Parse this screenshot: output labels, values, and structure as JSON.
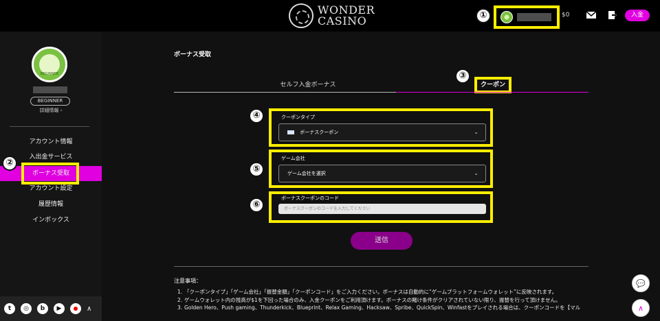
{
  "header": {
    "logo_line1": "WONDER",
    "logo_line2": "CASINO",
    "balance": "$0",
    "deposit_label": "入金"
  },
  "markers": [
    "①",
    "②",
    "③",
    "④",
    "⑤",
    "⑥"
  ],
  "sidebar": {
    "badge_label": "BEGINNER",
    "rank": "BEGINNER",
    "details": "詳細情報",
    "items": [
      {
        "label": "アカウント情報"
      },
      {
        "label": "入出金サービス"
      },
      {
        "label": "ボーナス受取"
      },
      {
        "label": "アカウント設定"
      },
      {
        "label": "履歴情報"
      },
      {
        "label": "インボックス"
      }
    ]
  },
  "main": {
    "title": "ボーナス受取",
    "tabs": [
      {
        "label": "セルフ入金ボーナス"
      },
      {
        "label": "クーポン"
      }
    ],
    "coupon_type": {
      "label": "クーポンタイプ",
      "value": "ボーナスクーポン"
    },
    "game_company": {
      "label": "ゲーム会社",
      "value": "ゲーム会社を選択"
    },
    "coupon_code": {
      "label": "ボーナスクーポンのコード",
      "placeholder": "ボーナスクーポンのコードを入力してください"
    },
    "submit_label": "送信",
    "notes_title": "注意事項：",
    "notes": [
      {
        "num": "1.",
        "text": "「クーポンタイプ」「ゲーム会社」「振替金額」「クーポンコード」をご入力ください。ボーナスは自動的に“ゲームプラットフォームウォレット”に反映されます。"
      },
      {
        "num": "2.",
        "text": "ゲームウォレット内の残高が$1を下回った場合のみ、入金クーポンをご利用頂けます。ボーナスの賭け条件がクリアされていない限り、振替を行って頂けません。"
      },
      {
        "num": "3.",
        "text": "Golden Hero、Push gaming、Thunderkick、Blueprint、Relax Gaming、Hacksaw、Spribe、QuickSpin、Winfastをプレイされる場合は、クーポンコードを【マル"
      }
    ]
  },
  "colors": {
    "accent": "#e000e0",
    "highlight": "#ffee00",
    "badge": "#7bc142"
  },
  "icons": [
    "mail-icon",
    "logout-icon",
    "twitter-icon",
    "instagram-icon",
    "blog-icon",
    "youtube-icon",
    "record-icon",
    "chevron-up-icon",
    "chat-icon"
  ]
}
